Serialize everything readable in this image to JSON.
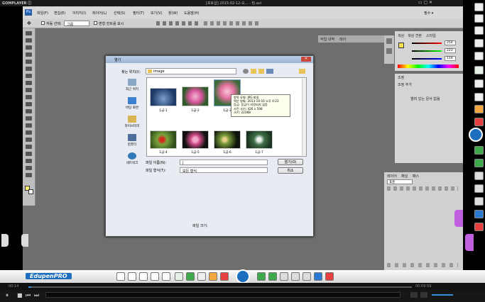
{
  "gom": {
    "logo": "GOMPLAYER ⓘ",
    "title": "[포토샵] 2015-02-12-오... - 빔.avi",
    "controls": "▭ ▢ ✕"
  },
  "menu": {
    "items": [
      "파일(F)",
      "편집(E)",
      "이미지(I)",
      "레이어(L)",
      "선택(S)",
      "필터(T)",
      "보기(V)",
      "창(W)",
      "도움말(H)"
    ],
    "workspace": "필수 ▾"
  },
  "options": {
    "auto_select": "자동 선택:",
    "group": "그룹",
    "show_transform": "변형 컨트롤 표시"
  },
  "panels": {
    "history_tabs": [
      "작업 내역",
      "레이"
    ],
    "color_tabs": [
      "색상",
      "색상 견본",
      "스타일"
    ],
    "color_values": [
      "254",
      "223",
      "114"
    ],
    "adjust_tab": "조정",
    "adjust_title": "조정 추가",
    "adjust_empty": "열려 있는 문서 없음",
    "layer_tabs": [
      "레이어",
      "채널",
      "패스"
    ],
    "layer_mode": "표준"
  },
  "dialog": {
    "title": "열기",
    "close": "✕",
    "look_in_label": "찾는 위치(I):",
    "look_in_value": "image",
    "places": [
      "최근 위치",
      "바탕 화면",
      "라이브러리",
      "컴퓨터",
      "네트워크"
    ],
    "files": [
      "1금-1",
      "1금-2",
      "1금-3",
      "1금-4",
      "1금-5",
      "1금-6",
      "1금-7",
      "1금-8"
    ],
    "tooltip": [
      "항목 유형: JPG 파일",
      "찍은 날짜: 2013-10-16 오후 4:23",
      "등급: 등급이 지정되지 않음",
      "사진 크기: 426 x 598",
      "크기: 223KB"
    ],
    "filename_label": "파일 이름(N):",
    "filetype_label": "파일 형식(T):",
    "filetype_value": "모든 형식",
    "open_button": "열기(O)",
    "cancel_button": "취소",
    "filesize_label": "파일 크기:"
  },
  "bottom": {
    "logo": "EdupenPRO",
    "time_start": "00:14",
    "time_end": "00:09:59"
  }
}
